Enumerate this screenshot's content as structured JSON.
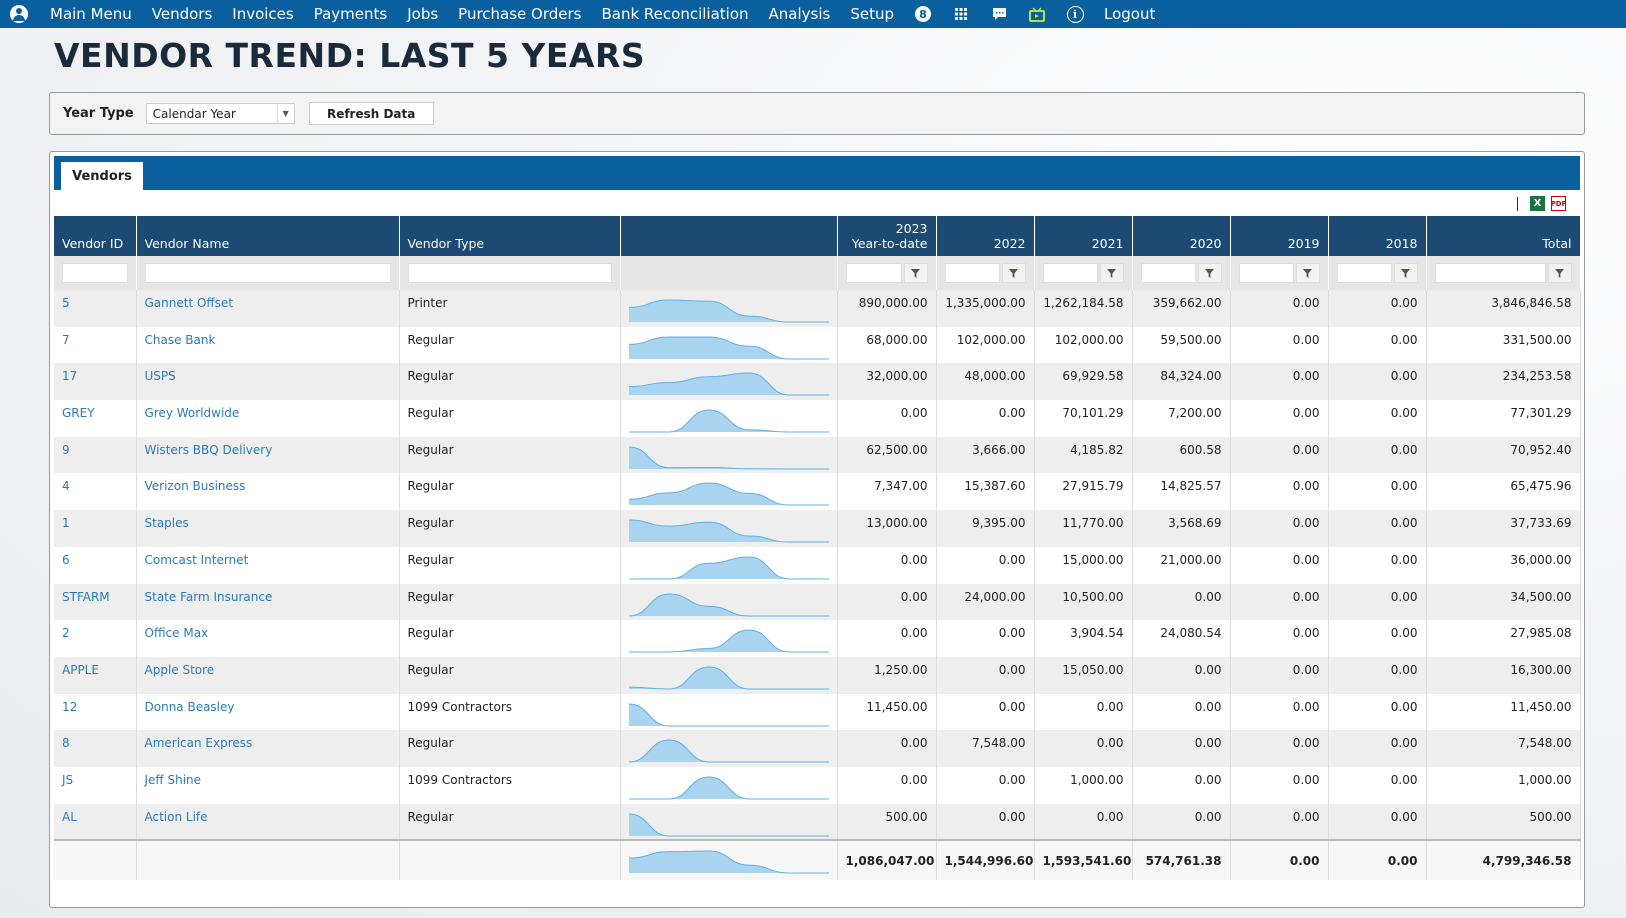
{
  "nav": {
    "items": [
      "Main Menu",
      "Vendors",
      "Invoices",
      "Payments",
      "Jobs",
      "Purchase Orders",
      "Bank Reconciliation",
      "Analysis",
      "Setup"
    ],
    "badge_count": "8",
    "logout": "Logout",
    "icons": [
      "user-icon",
      "badge-icon",
      "apps-grid-icon",
      "chat-icon",
      "tv-icon",
      "info-icon"
    ]
  },
  "page_title": "VENDOR TREND: LAST 5 YEARS",
  "filter": {
    "year_type_label": "Year Type",
    "year_type_value": "Calendar Year",
    "refresh_label": "Refresh Data"
  },
  "tab_label": "Vendors",
  "columns": {
    "vendor_id": "Vendor ID",
    "vendor_name": "Vendor Name",
    "vendor_type": "Vendor Type",
    "spark": "",
    "y2023_a": "2023",
    "y2023_b": "Year-to-date",
    "y2022": "2022",
    "y2021": "2021",
    "y2020": "2020",
    "y2019": "2019",
    "y2018": "2018",
    "total": "Total"
  },
  "rows": [
    {
      "id": "5",
      "name": "Gannett Offset",
      "type": "Printer",
      "y2023": "890,000.00",
      "y2022": "1,335,000.00",
      "y2021": "1,262,184.58",
      "y2020": "359,662.00",
      "y2019": "0.00",
      "y2018": "0.00",
      "total": "3,846,846.58",
      "trend": [
        890000,
        1335000,
        1262184.58,
        359662,
        0,
        0
      ]
    },
    {
      "id": "7",
      "name": "Chase Bank",
      "type": "Regular",
      "y2023": "68,000.00",
      "y2022": "102,000.00",
      "y2021": "102,000.00",
      "y2020": "59,500.00",
      "y2019": "0.00",
      "y2018": "0.00",
      "total": "331,500.00",
      "trend": [
        68000,
        102000,
        102000,
        59500,
        0,
        0
      ]
    },
    {
      "id": "17",
      "name": "USPS",
      "type": "Regular",
      "y2023": "32,000.00",
      "y2022": "48,000.00",
      "y2021": "69,929.58",
      "y2020": "84,324.00",
      "y2019": "0.00",
      "y2018": "0.00",
      "total": "234,253.58",
      "trend": [
        32000,
        48000,
        69929.58,
        84324,
        0,
        0
      ]
    },
    {
      "id": "GREY",
      "name": "Grey Worldwide",
      "type": "Regular",
      "y2023": "0.00",
      "y2022": "0.00",
      "y2021": "70,101.29",
      "y2020": "7,200.00",
      "y2019": "0.00",
      "y2018": "0.00",
      "total": "77,301.29",
      "trend": [
        0,
        0,
        70101.29,
        7200,
        0,
        0
      ]
    },
    {
      "id": "9",
      "name": "Wisters BBQ Delivery",
      "type": "Regular",
      "y2023": "62,500.00",
      "y2022": "3,666.00",
      "y2021": "4,185.82",
      "y2020": "600.58",
      "y2019": "0.00",
      "y2018": "0.00",
      "total": "70,952.40",
      "trend": [
        62500,
        3666,
        4185.82,
        600.58,
        0,
        0
      ]
    },
    {
      "id": "4",
      "name": "Verizon Business",
      "type": "Regular",
      "y2023": "7,347.00",
      "y2022": "15,387.60",
      "y2021": "27,915.79",
      "y2020": "14,825.57",
      "y2019": "0.00",
      "y2018": "0.00",
      "total": "65,475.96",
      "trend": [
        7347,
        15387.6,
        27915.79,
        14825.57,
        0,
        0
      ]
    },
    {
      "id": "1",
      "name": "Staples",
      "type": "Regular",
      "y2023": "13,000.00",
      "y2022": "9,395.00",
      "y2021": "11,770.00",
      "y2020": "3,568.69",
      "y2019": "0.00",
      "y2018": "0.00",
      "total": "37,733.69",
      "trend": [
        13000,
        9395,
        11770,
        3568.69,
        0,
        0
      ]
    },
    {
      "id": "6",
      "name": "Comcast Internet",
      "type": "Regular",
      "y2023": "0.00",
      "y2022": "0.00",
      "y2021": "15,000.00",
      "y2020": "21,000.00",
      "y2019": "0.00",
      "y2018": "0.00",
      "total": "36,000.00",
      "trend": [
        0,
        0,
        15000,
        21000,
        0,
        0
      ]
    },
    {
      "id": "STFARM",
      "name": "State Farm Insurance",
      "type": "Regular",
      "y2023": "0.00",
      "y2022": "24,000.00",
      "y2021": "10,500.00",
      "y2020": "0.00",
      "y2019": "0.00",
      "y2018": "0.00",
      "total": "34,500.00",
      "trend": [
        0,
        24000,
        10500,
        0,
        0,
        0
      ]
    },
    {
      "id": "2",
      "name": "Office Max",
      "type": "Regular",
      "y2023": "0.00",
      "y2022": "0.00",
      "y2021": "3,904.54",
      "y2020": "24,080.54",
      "y2019": "0.00",
      "y2018": "0.00",
      "total": "27,985.08",
      "trend": [
        0,
        0,
        3904.54,
        24080.54,
        0,
        0
      ]
    },
    {
      "id": "APPLE",
      "name": "Apple Store",
      "type": "Regular",
      "y2023": "1,250.00",
      "y2022": "0.00",
      "y2021": "15,050.00",
      "y2020": "0.00",
      "y2019": "0.00",
      "y2018": "0.00",
      "total": "16,300.00",
      "trend": [
        1250,
        0,
        15050,
        0,
        0,
        0
      ]
    },
    {
      "id": "12",
      "name": "Donna Beasley",
      "type": "1099 Contractors",
      "y2023": "11,450.00",
      "y2022": "0.00",
      "y2021": "0.00",
      "y2020": "0.00",
      "y2019": "0.00",
      "y2018": "0.00",
      "total": "11,450.00",
      "trend": [
        11450,
        0,
        0,
        0,
        0,
        0
      ]
    },
    {
      "id": "8",
      "name": "American Express",
      "type": "Regular",
      "y2023": "0.00",
      "y2022": "7,548.00",
      "y2021": "0.00",
      "y2020": "0.00",
      "y2019": "0.00",
      "y2018": "0.00",
      "total": "7,548.00",
      "trend": [
        0,
        7548,
        0,
        0,
        0,
        0
      ]
    },
    {
      "id": "JS",
      "name": "Jeff Shine",
      "type": "1099 Contractors",
      "y2023": "0.00",
      "y2022": "0.00",
      "y2021": "1,000.00",
      "y2020": "0.00",
      "y2019": "0.00",
      "y2018": "0.00",
      "total": "1,000.00",
      "trend": [
        0,
        0,
        1000,
        0,
        0,
        0
      ]
    },
    {
      "id": "AL",
      "name": "Action Life",
      "type": "Regular",
      "y2023": "500.00",
      "y2022": "0.00",
      "y2021": "0.00",
      "y2020": "0.00",
      "y2019": "0.00",
      "y2018": "0.00",
      "total": "500.00",
      "trend": [
        500,
        0,
        0,
        0,
        0,
        0
      ]
    }
  ],
  "totals": {
    "y2023": "1,086,047.00",
    "y2022": "1,544,996.60",
    "y2021": "1,593,541.60",
    "y2020": "574,761.38",
    "y2019": "0.00",
    "y2018": "0.00",
    "total": "4,799,346.58",
    "trend": [
      1086047,
      1544996.6,
      1593541.6,
      574761.38,
      0,
      0
    ]
  },
  "colors": {
    "nav_bg": "#0a5f9e",
    "header_bg": "#1d4a72",
    "link": "#2a7ab8",
    "spark_fill": "#a9d4ef",
    "spark_stroke": "#5fb1e3"
  }
}
